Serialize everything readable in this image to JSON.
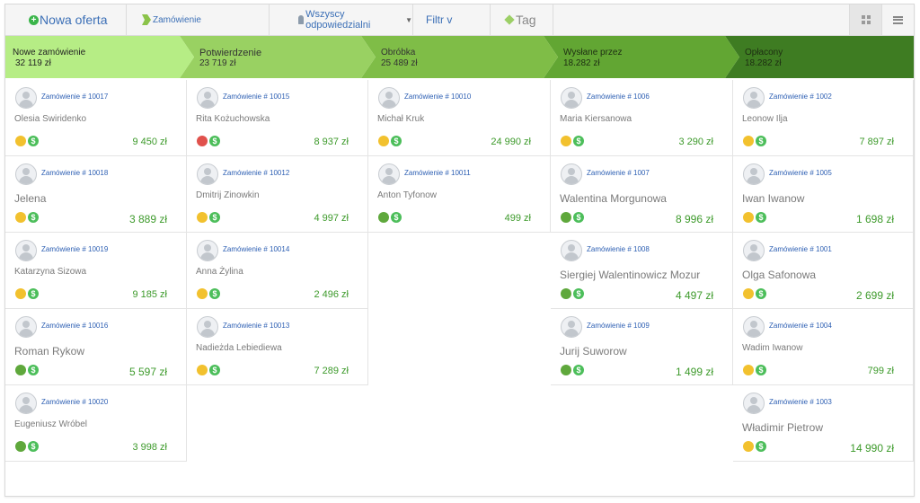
{
  "toolbar": {
    "new_offer": "Nowa oferta",
    "order_type": "Zamówienie",
    "responsible": "Wszyscy odpowiedzialni",
    "filter": "Filtr v",
    "tag": "Tag"
  },
  "colors": {
    "stage_1": "#b6ed85",
    "stage_2": "#99d162",
    "stage_3": "#7fbd47",
    "stage_4": "#62a633",
    "stage_5": "#3e7c22",
    "amount": "#3d9a2b",
    "link": "#2d5fb3"
  },
  "stages": [
    {
      "name": "Nowe zamówienie",
      "sum": "32 119 zł"
    },
    {
      "name": "Potwierdzenie",
      "sum": "23 719 zł"
    },
    {
      "name": "Obróbka",
      "sum": "25 489 zł"
    },
    {
      "name": "Wysłane przez",
      "sum": "18.282 zł"
    },
    {
      "name": "Opłacony",
      "sum": "18.282 zł"
    }
  ],
  "columns": [
    {
      "cards": [
        {
          "order": "Zamówienie # 10017",
          "client": "Olesia Swiridenko",
          "status": "yellow",
          "amount": "9 450 zł"
        },
        {
          "order": "Zamówienie # 10018",
          "client": "Jelena",
          "status": "yellow",
          "amount": "3 889 zł"
        },
        {
          "order": "Zamówienie # 10019",
          "client": "Katarzyna Sizowa",
          "status": "yellow",
          "amount": "9 185 zł"
        },
        {
          "order": "Zamówienie # 10016",
          "client": "Roman Rykow",
          "status": "green",
          "amount": "5 597 zł"
        },
        {
          "order": "Zamówienie # 10020",
          "client": "Eugeniusz Wróbel",
          "status": "green",
          "amount": "3 998 zł"
        }
      ]
    },
    {
      "cards": [
        {
          "order": "Zamówienie # 10015",
          "client": "Rita Kożuchowska",
          "status": "red",
          "amount": "8 937 zł"
        },
        {
          "order": "Zamówienie # 10012",
          "client": "Dmitrij Zinowkin",
          "status": "yellow",
          "amount": "4 997 zł"
        },
        {
          "order": "Zamówienie # 10014",
          "client": "Anna Żylina",
          "status": "yellow",
          "amount": "2 496 zł"
        },
        {
          "order": "Zamówienie # 10013",
          "client": "Nadieżda Lebiediewa",
          "status": "yellow",
          "amount": "7 289 zł"
        }
      ]
    },
    {
      "cards": [
        {
          "order": "Zamówienie # 10010",
          "client": "Michał Kruk",
          "status": "yellow",
          "amount": "24 990 zł"
        },
        {
          "order": "Zamówienie # 10011",
          "client": "Anton Tyfonow",
          "status": "green",
          "amount": "499 zł"
        }
      ]
    },
    {
      "cards": [
        {
          "order": "Zamówienie # 1006",
          "client": "Maria Kiersanowa",
          "status": "yellow",
          "amount": "3 290 zł"
        },
        {
          "order": "Zamówienie # 1007",
          "client": "Walentina Morgunowa",
          "status": "green",
          "amount": "8 996 zł"
        },
        {
          "order": "Zamówienie # 1008",
          "client": "Siergiej Walentinowicz Mozur",
          "status": "green",
          "amount": "4 497 zł"
        },
        {
          "order": "Zamówienie # 1009",
          "client": "Jurij Suworow",
          "status": "green",
          "amount": "1 499 zł"
        }
      ]
    },
    {
      "cards": [
        {
          "order": "Zamówienie # 1002",
          "client": "Leonow Ilja",
          "status": "yellow",
          "amount": "7 897 zł"
        },
        {
          "order": "Zamówienie # 1005",
          "client": "Iwan Iwanow",
          "status": "yellow",
          "amount": "1 698 zł"
        },
        {
          "order": "Zamówienie # 1001",
          "client": "Olga Safonowa",
          "status": "yellow",
          "amount": "2 699 zł"
        },
        {
          "order": "Zamówienie # 1004",
          "client": "Wadim Iwanow",
          "status": "yellow",
          "amount": "799 zł"
        },
        {
          "order": "Zamówienie # 1003",
          "client": "Władimir Pietrow",
          "status": "yellow",
          "amount": "14 990 zł"
        }
      ]
    }
  ]
}
